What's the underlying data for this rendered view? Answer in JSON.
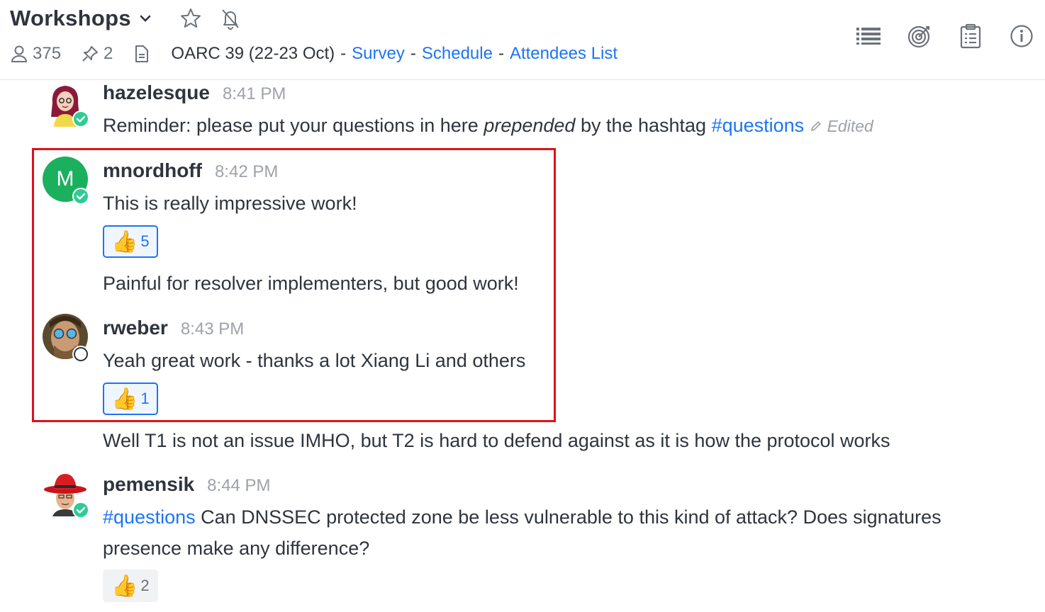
{
  "header": {
    "channel_name": "Workshops",
    "members_count": "375",
    "pinned_count": "2",
    "topic": {
      "text": "OARC 39 (22-23 Oct)",
      "sep1": "-",
      "link1": "Survey",
      "sep2": "-",
      "link2": "Schedule",
      "sep3": "-",
      "link3": "Attendees List"
    },
    "icons": [
      "chevron-down-icon",
      "star-icon",
      "bell-off-icon",
      "user-icon",
      "pin-icon",
      "document-icon",
      "list-icon",
      "target-icon",
      "clipboard-icon",
      "info-icon"
    ]
  },
  "messages": [
    {
      "username": "hazelesque",
      "time": "8:41 PM",
      "text_before": "Reminder: please put your questions in here ",
      "text_em": "prepended",
      "text_after": " by the hashtag ",
      "hashtag": "#questions",
      "edited": "Edited",
      "status": "online"
    },
    {
      "username": "mnordhoff",
      "time": "8:42 PM",
      "avatar_letter": "M",
      "avatar_color": "#1bb05e",
      "text": "This is really impressive work!",
      "reaction_count": "5",
      "followup": "Painful for resolver implementers, but good work!",
      "status": "online"
    },
    {
      "username": "rweber",
      "time": "8:43 PM",
      "text": "Yeah great work - thanks a lot Xiang Li and others",
      "reaction_count": "1",
      "followup": "Well T1 is not an issue IMHO, but T2 is hard to defend against as it is how the protocol works",
      "status": "offline"
    },
    {
      "username": "pemensik",
      "time": "8:44 PM",
      "hashtag": "#questions",
      "text_line1": " Can DNSSEC protected zone be less vulnerable to this kind of attack? Does signatures",
      "text_line2": "presence make any difference?",
      "reaction_count": "2",
      "status": "online"
    }
  ],
  "colors": {
    "link": "#1d74f5",
    "online": "#2de0a5",
    "highlight_border": "#e0101a"
  }
}
